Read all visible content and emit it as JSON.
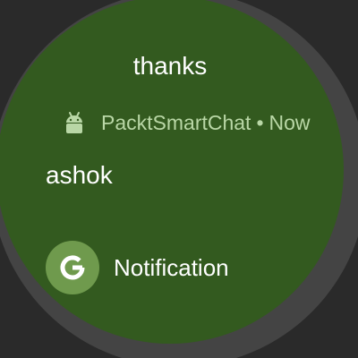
{
  "notification": {
    "title": "thanks",
    "app_name": "PacktSmartChat",
    "separator": "•",
    "time": "Now",
    "sender": "ashok",
    "action_label": "Notification",
    "action_icon_letter": "G"
  },
  "colors": {
    "face_background": "#335a1f",
    "accent_text": "#b9d7a6",
    "action_circle": "#6f9a4d"
  },
  "icons": {
    "app_icon": "android-icon",
    "action_icon": "google-g-icon"
  }
}
